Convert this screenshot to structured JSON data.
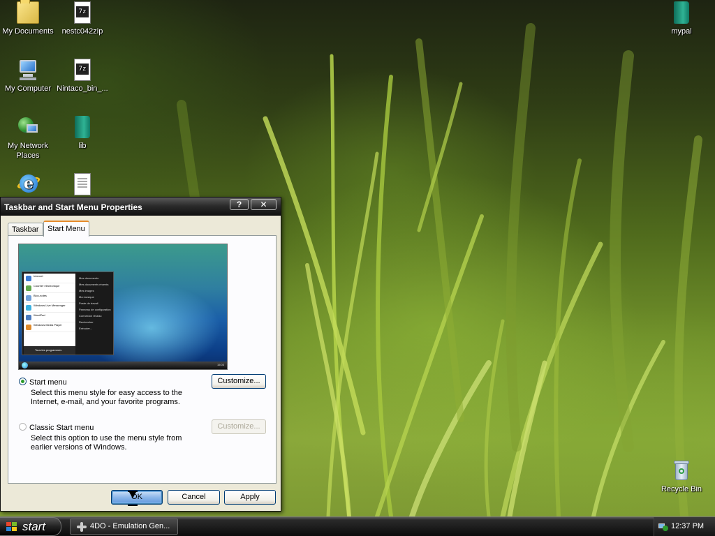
{
  "desktop": {
    "icons": {
      "my_documents": "My Documents",
      "nestc": "nestc042zip",
      "mypal": "mypal",
      "my_computer": "My Computer",
      "nintaco": "Nintaco_bin_...",
      "my_network": "My Network Places",
      "lib": "lib",
      "recycle_bin": "Recycle Bin"
    }
  },
  "dialog": {
    "title": "Taskbar and Start Menu Properties",
    "help_glyph": "?",
    "close_glyph": "✕",
    "tabs": [
      {
        "label": "Taskbar",
        "selected": false
      },
      {
        "label": "Start Menu",
        "selected": true
      }
    ],
    "preview": {
      "left_items": [
        "Internet",
        "Courrier électronique",
        "Bloc-notes",
        "Windows Live Messenger",
        "WordPad",
        "Windows Media Player"
      ],
      "all_programs": "Tous les programmes",
      "right_items": [
        "Mes documents",
        "Mes documents récents",
        "Mes images",
        "Ma musique",
        "Poste de travail",
        "Panneau de configuration",
        "Connexion réseau",
        "Rechercher",
        "Exécuter..."
      ],
      "clock": "15:03"
    },
    "options": {
      "start_menu": {
        "label": "Start menu",
        "selected": true,
        "description": "Select this menu style for easy access to the Internet, e-mail, and your favorite programs.",
        "customize_label": "Customize..."
      },
      "classic": {
        "label": "Classic Start menu",
        "selected": false,
        "description": "Select this option to use the menu style from earlier versions of Windows.",
        "customize_label": "Customize..."
      }
    },
    "buttons": {
      "ok": "OK",
      "cancel": "Cancel",
      "apply": "Apply"
    }
  },
  "taskbar": {
    "start_label": "start",
    "items": [
      {
        "label": "4DO - Emulation Gen..."
      }
    ],
    "clock": "12:37 PM"
  },
  "colors": {
    "titlebar": "#1a1a1a",
    "dialog_face": "#ece9d8",
    "tab_highlight": "#e68b2c",
    "button_border": "#003c74"
  }
}
